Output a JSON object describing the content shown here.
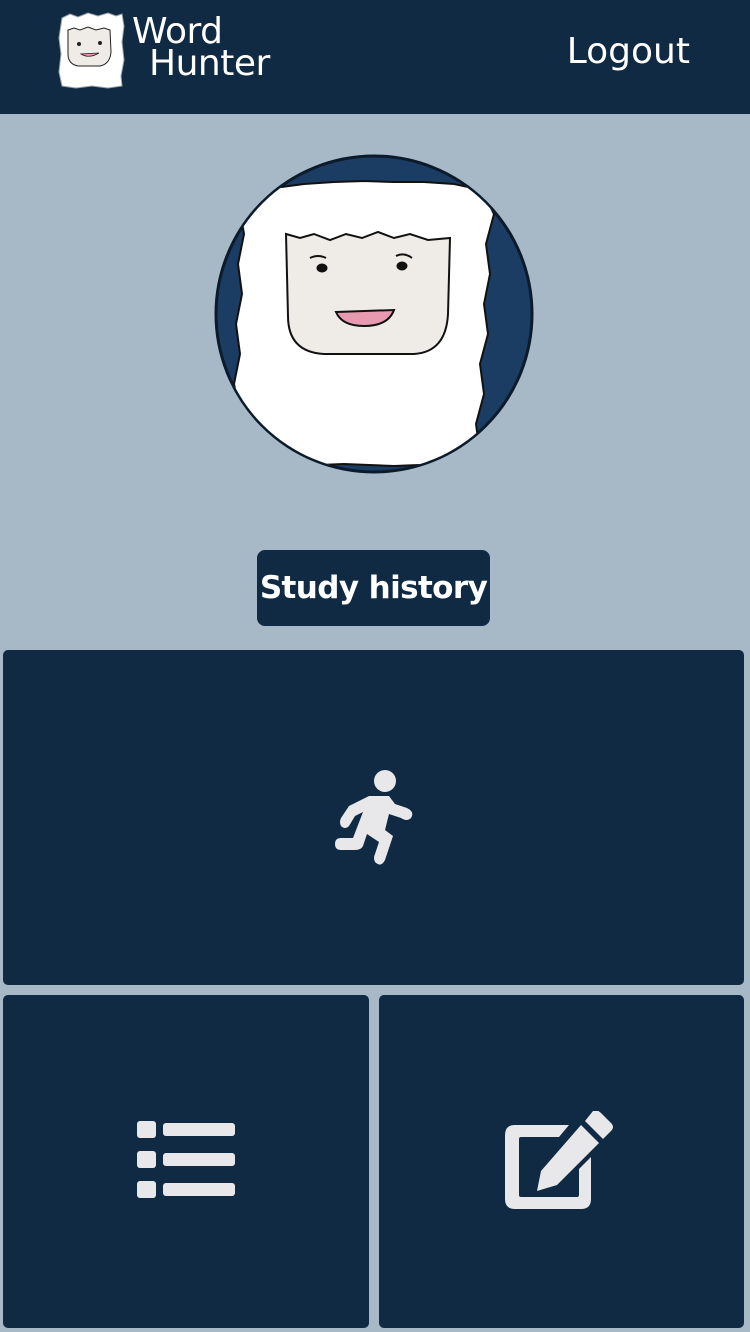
{
  "header": {
    "logo_line1": "Word",
    "logo_line2": "Hunter",
    "logout_label": "Logout"
  },
  "profile": {
    "history_button_label": "Study history"
  },
  "tiles": [
    {
      "name": "play",
      "icon": "running-person-icon"
    },
    {
      "name": "word-list",
      "icon": "list-icon"
    },
    {
      "name": "edit",
      "icon": "edit-icon"
    }
  ],
  "colors": {
    "background": "#a7b9c7",
    "navy": "#0f2a42",
    "avatar_ring": "#1c3d63",
    "icon": "#e8e8ea",
    "text": "#ffffff",
    "mouth": "#e89ab0",
    "face": "#efebe6"
  }
}
